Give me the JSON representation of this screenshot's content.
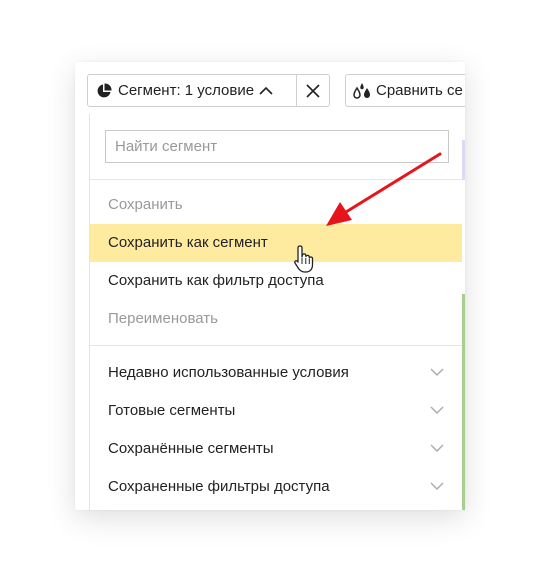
{
  "toolbar": {
    "segment_label": "Сегмент: 1 условие",
    "segment_icon": "pie-chart-icon",
    "compare_label": "Сравнить се",
    "compare_icon": "drops-icon",
    "close_icon": "close-icon"
  },
  "search": {
    "placeholder": "Найти сегмент",
    "value": ""
  },
  "menu": {
    "items": [
      {
        "label": "Сохранить",
        "state": "disabled"
      },
      {
        "label": "Сохранить как сегмент",
        "state": "highlighted"
      },
      {
        "label": "Сохранить как фильтр доступа",
        "state": "enabled"
      },
      {
        "label": "Переименовать",
        "state": "disabled"
      }
    ]
  },
  "groups": [
    {
      "label": "Недавно использованные условия"
    },
    {
      "label": "Готовые сегменты"
    },
    {
      "label": "Сохранённые сегменты"
    },
    {
      "label": "Сохраненные фильтры доступа"
    }
  ],
  "colors": {
    "highlight": "#ffeba0",
    "annotation_arrow": "#e8141b",
    "accent_green": "#a8cf8f"
  }
}
